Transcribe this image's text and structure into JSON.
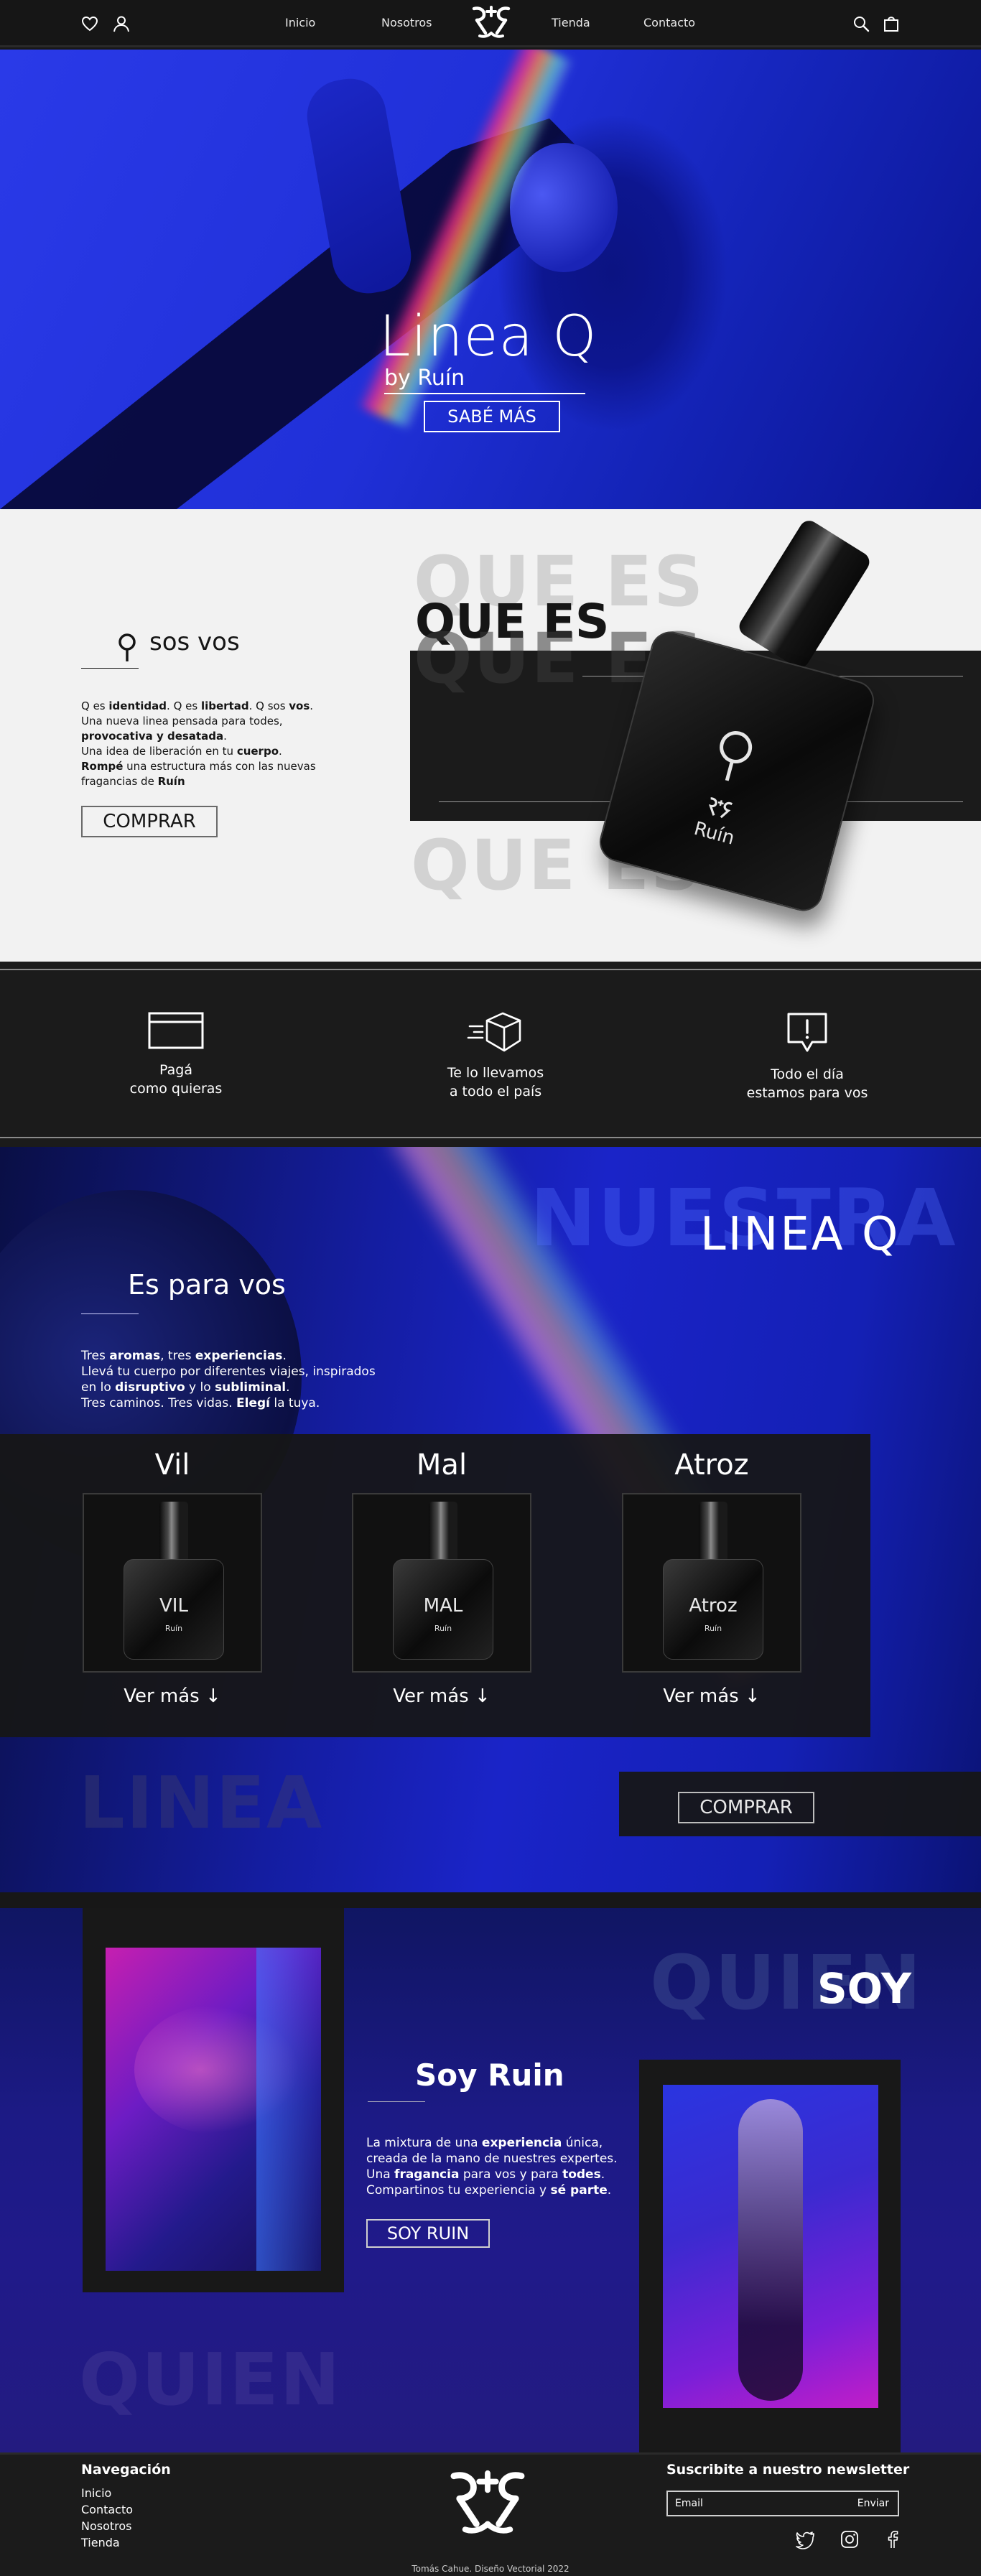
{
  "nav": {
    "links": [
      "Inicio",
      "Nosotros",
      "Tienda",
      "Contacto"
    ]
  },
  "hero": {
    "title": "Linea Q",
    "subtitle": "by Ruín",
    "button": "SABÉ MÁS"
  },
  "q_section": {
    "ghost_top": "QUE ES",
    "title": "QUE ES",
    "ghost_mid": "QUE ES",
    "ghost_bottom": "QUE ES",
    "heading": "sos vos",
    "paragraph": [
      {
        "parts": [
          {
            "t": "Q es ",
            "b": false
          },
          {
            "t": "identidad",
            "b": true
          },
          {
            "t": ". Q es ",
            "b": false
          },
          {
            "t": "libertad",
            "b": true
          },
          {
            "t": ". Q sos ",
            "b": false
          },
          {
            "t": "vos",
            "b": true
          },
          {
            "t": ".",
            "b": false
          }
        ]
      },
      {
        "parts": [
          {
            "t": "Una nueva linea pensada para todes,",
            "b": false
          }
        ]
      },
      {
        "parts": [
          {
            "t": "provocativa y desatada",
            "b": true
          },
          {
            "t": ".",
            "b": false
          }
        ]
      },
      {
        "parts": [
          {
            "t": "Una idea de liberación en tu ",
            "b": false
          },
          {
            "t": "cuerpo",
            "b": true
          },
          {
            "t": ".",
            "b": false
          }
        ]
      },
      {
        "parts": [
          {
            "t": "Rompé",
            "b": true
          },
          {
            "t": " una  estructura más con las nuevas",
            "b": false
          }
        ]
      },
      {
        "parts": [
          {
            "t": "fragancias de ",
            "b": false
          },
          {
            "t": "Ruín",
            "b": true
          }
        ]
      }
    ],
    "button": "COMPRAR",
    "bottle_brand": "Ruín"
  },
  "features": [
    {
      "icon": "card-icon",
      "line1": "Pagá",
      "line2": "como quieras"
    },
    {
      "icon": "box-delivery-icon",
      "line1": "Te lo llevamos",
      "line2": "a todo el país"
    },
    {
      "icon": "alert-chat-icon",
      "line1": "Todo el día",
      "line2": "estamos para vos"
    }
  ],
  "linea": {
    "ghost_top": "NUESTRA",
    "title": "LINEA Q",
    "heading": "Es para vos",
    "paragraph": [
      {
        "parts": [
          {
            "t": "Tres ",
            "b": false
          },
          {
            "t": "aromas",
            "b": true
          },
          {
            "t": ", tres ",
            "b": false
          },
          {
            "t": "experiencias",
            "b": true
          },
          {
            "t": ".",
            "b": false
          }
        ]
      },
      {
        "parts": [
          {
            "t": "Llevá tu cuerpo por diferentes viajes, inspirados",
            "b": false
          }
        ]
      },
      {
        "parts": [
          {
            "t": "en lo ",
            "b": false
          },
          {
            "t": "disruptivo",
            "b": true
          },
          {
            "t": " y lo ",
            "b": false
          },
          {
            "t": "subliminal",
            "b": true
          },
          {
            "t": ".",
            "b": false
          }
        ]
      },
      {
        "parts": [
          {
            "t": "Tres caminos. Tres vidas. ",
            "b": false
          },
          {
            "t": "Elegí",
            "b": true
          },
          {
            "t": " la tuya.",
            "b": false
          }
        ]
      }
    ],
    "products": [
      {
        "name": "Vil",
        "label": "VIL",
        "brand": "Ruín",
        "more": "Ver más ↓"
      },
      {
        "name": "Mal",
        "label": "MAL",
        "brand": "Ruín",
        "more": "Ver más ↓"
      },
      {
        "name": "Atroz",
        "label": "Atroz",
        "brand": "Ruín",
        "more": "Ver más ↓"
      }
    ],
    "ghost_bottom": "LINEA",
    "button": "COMPRAR"
  },
  "soy": {
    "ghost_top": "QUIEN",
    "big": "SOY",
    "heading": "Soy Ruin",
    "paragraph": [
      {
        "parts": [
          {
            "t": "La mixtura de una ",
            "b": false
          },
          {
            "t": "experiencia",
            "b": true
          },
          {
            "t": " única,",
            "b": false
          }
        ]
      },
      {
        "parts": [
          {
            "t": "creada de la mano de nuestres expertes.",
            "b": false
          }
        ]
      },
      {
        "parts": [
          {
            "t": "Una ",
            "b": false
          },
          {
            "t": "fragancia",
            "b": true
          },
          {
            "t": " para vos y para ",
            "b": false
          },
          {
            "t": "todes",
            "b": true
          },
          {
            "t": ".",
            "b": false
          }
        ]
      },
      {
        "parts": [
          {
            "t": "Compartinos tu experiencia y ",
            "b": false
          },
          {
            "t": "sé parte",
            "b": true
          },
          {
            "t": ".",
            "b": false
          }
        ]
      }
    ],
    "button": "SOY RUIN",
    "ghost_bottom": "QUIEN"
  },
  "footer": {
    "nav_title": "Navegación",
    "nav_links": [
      "Inicio",
      "Contacto",
      "Nosotros",
      "Tienda"
    ],
    "newsletter_title": "Suscribite a nuestro newsletter",
    "newsletter_placeholder": "Email",
    "newsletter_button": "Enviar",
    "social": [
      "twitter-icon",
      "instagram-icon",
      "facebook-icon"
    ],
    "credit": "Tomás Cahue. Diseño Vectorial 2022"
  },
  "colors": {
    "dark": "#1b1b1b",
    "hero_blue": "#1d2bcf",
    "light": "#f2f2f2",
    "ghost_gray": "#d2d2d2"
  }
}
